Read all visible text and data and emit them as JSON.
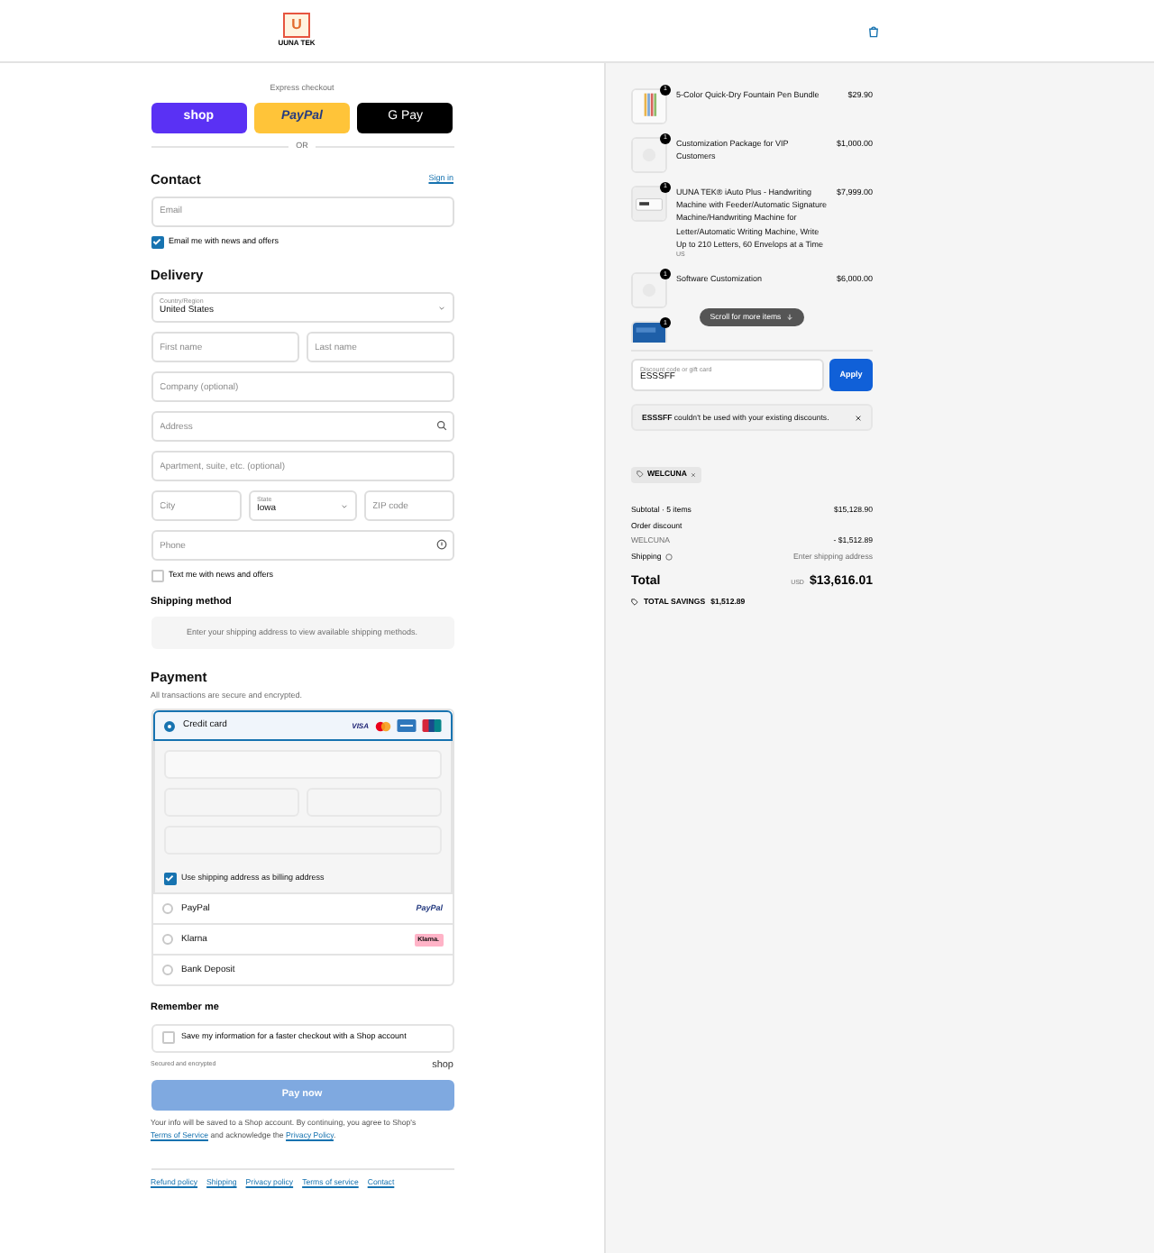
{
  "header": {
    "logo_mark": "U",
    "logo_text": "UUNA TEK"
  },
  "express": {
    "title": "Express checkout",
    "buttons": [
      {
        "kind": "shop",
        "label": "shop"
      },
      {
        "kind": "paypal",
        "label": "PayPal"
      },
      {
        "kind": "gpay",
        "label": "G Pay"
      }
    ],
    "divider": "OR"
  },
  "contact": {
    "title": "Contact",
    "sign_in": "Sign in",
    "email": {
      "placeholder": "Email"
    },
    "newsletter": {
      "label": "Email me with news and offers",
      "checked": true
    }
  },
  "delivery": {
    "title": "Delivery",
    "country": {
      "label": "Country/Region",
      "value": "United States"
    },
    "first_name": {
      "placeholder": "First name"
    },
    "last_name": {
      "placeholder": "Last name"
    },
    "company": {
      "placeholder": "Company (optional)"
    },
    "address": {
      "placeholder": "Address"
    },
    "apartment": {
      "placeholder": "Apartment, suite, etc. (optional)"
    },
    "city": {
      "placeholder": "City"
    },
    "state": {
      "label": "State",
      "value": "Iowa"
    },
    "zip": {
      "placeholder": "ZIP code"
    },
    "phone": {
      "placeholder": "Phone"
    },
    "sms": {
      "label": "Text me with news and offers",
      "checked": false
    }
  },
  "shipping_method": {
    "title": "Shipping method",
    "notice": "Enter your shipping address to view available shipping methods."
  },
  "payment": {
    "title": "Payment",
    "subtitle": "All transactions are secure and encrypted.",
    "methods": [
      {
        "kind": "card",
        "label": "Credit card",
        "selected": true,
        "logo": "VISA",
        "billing": {
          "label": "Use shipping address as billing address",
          "checked": true
        }
      },
      {
        "kind": "paypal",
        "label": "PayPal",
        "selected": false,
        "logo": "PayPal"
      },
      {
        "kind": "klarna",
        "label": "Klarna",
        "selected": false,
        "logo": "Klarna."
      },
      {
        "kind": "plain",
        "label": "Bank Deposit",
        "selected": false
      }
    ]
  },
  "remember": {
    "title": "Remember me",
    "option": {
      "label": "Save my information for a faster checkout with a Shop account",
      "checked": false
    },
    "secured": "Secured and encrypted",
    "shop_logo": "shop"
  },
  "pay_button": "Pay now",
  "legal": {
    "before": "Your info will be saved to a Shop account. By continuing, you agree to Shop's",
    "terms": "Terms of Service",
    "middle": "and acknowledge the",
    "privacy": "Privacy Policy",
    "after": "."
  },
  "footer_links": [
    "Refund policy",
    "Shipping",
    "Privacy policy",
    "Terms of service",
    "Contact"
  ],
  "cart": {
    "items": [
      {
        "quantity": "1",
        "title": "5-Color Quick-Dry Fountain Pen Bundle",
        "price": "$29.90"
      },
      {
        "quantity": "1",
        "title": "Customization Package for VIP Customers",
        "price": "$1,000.00"
      },
      {
        "quantity": "1",
        "title": "UUNA TEK® iAuto Plus - Handwriting Machine with Feeder/Automatic Signature Machine/Handwriting Machine for Letter/Automatic Writing Machine, Write Up to 210 Letters, 60 Envelops at a Time",
        "variant": "US",
        "price": "$7,999.00"
      },
      {
        "quantity": "1",
        "title": "Software Customization",
        "price": "$6,000.00"
      },
      {
        "quantity": "1"
      }
    ],
    "scroll_hint": "Scroll for more items",
    "discount": {
      "label": "Discount code or gift card",
      "value": "ESSSFF",
      "button": "Apply"
    },
    "error": {
      "text": "**ESSSFF** couldn't be used with your existing discounts."
    },
    "applied_code": "WELCUNA",
    "summary": {
      "subtotal_label": "Subtotal · 5 items",
      "subtotal": "$15,128.90",
      "discount_label": "Order discount",
      "discount_code": "WELCUNA",
      "discount_value": "- $1,512.89",
      "shipping_label": "Shipping",
      "shipping_value": "Enter shipping address",
      "total_label": "Total",
      "currency": "USD",
      "total": "$13,616.01",
      "savings_label": "TOTAL SAVINGS",
      "savings": "$1,512.89"
    }
  }
}
